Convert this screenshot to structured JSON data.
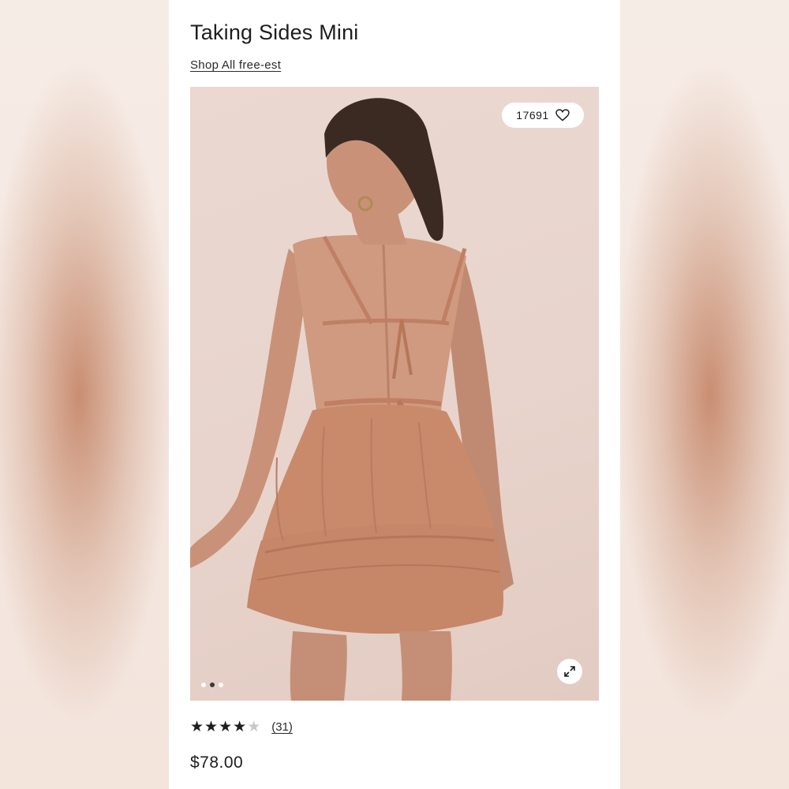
{
  "product": {
    "title": "Taking Sides Mini",
    "shop_link": "Shop All free-est",
    "favorites_count": "17691",
    "rating": 4,
    "rating_max": 5,
    "review_count": "(31)",
    "price": "$78.00"
  },
  "gallery": {
    "image_count": 3,
    "active_index": 1
  },
  "icons": {
    "favorite": "heart-icon",
    "expand": "expand-icon"
  },
  "colors": {
    "dress": "#c88a6e",
    "background": "#e8d4cc",
    "text": "#1e1e1e"
  }
}
